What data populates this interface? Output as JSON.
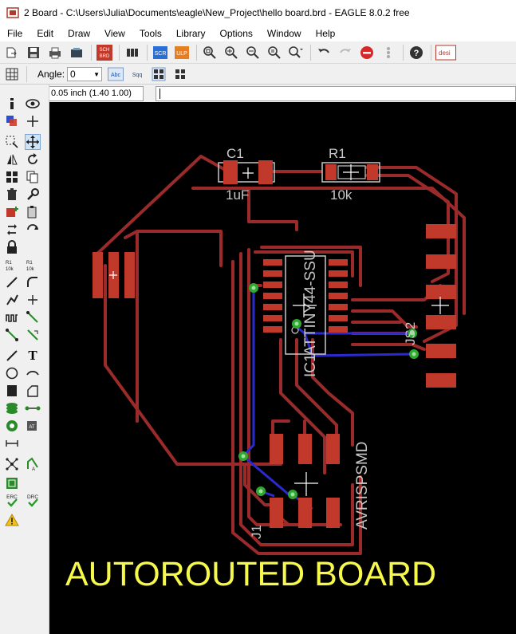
{
  "window": {
    "title": "2 Board - C:\\Users\\Julia\\Documents\\eagle\\New_Project\\hello board.brd - EAGLE 8.0.2 free"
  },
  "menu": {
    "items": [
      "File",
      "Edit",
      "Draw",
      "View",
      "Tools",
      "Library",
      "Options",
      "Window",
      "Help"
    ]
  },
  "toolbar": {
    "sch_label": "SCH",
    "brd_label": "BRD",
    "scr_label": "SCR",
    "ulp_label": "ULP",
    "design_label": "desi"
  },
  "params": {
    "angle_label": "Angle:",
    "angle_value": "0",
    "abc_label": "Abc",
    "sqq_label": "Sqq"
  },
  "coords": {
    "grid_readout": "0.05 inch (1.40 1.00)",
    "command_value": ""
  },
  "leftpanel": {
    "tool_t_label": "T",
    "erc_label": "ERC",
    "drc_label": "DRC"
  },
  "board": {
    "labels": {
      "c1": "C1",
      "c1_value": "1uF",
      "r1": "R1",
      "r1_value": "10k",
      "ic1_value": "ATTINY44-SSU",
      "ic1": "IC1",
      "js2": "JS2",
      "j1": "J1",
      "j1_value": "AVRISPSMD"
    },
    "colors": {
      "background": "#000000",
      "top_layer": "#9b2a2a",
      "bottom_layer": "#2a2ad0",
      "via": "#2fa82f",
      "silk": "#c8c8c8"
    }
  },
  "caption": {
    "text": "AUTOROUTED BOARD"
  }
}
